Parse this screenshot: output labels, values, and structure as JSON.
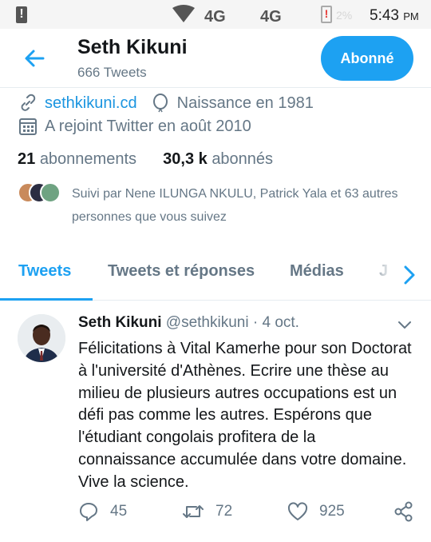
{
  "status_bar": {
    "network_1": "4G",
    "network_2": "4G",
    "battery": "2%",
    "time": "5:43",
    "ampm": "PM"
  },
  "header": {
    "name": "Seth Kikuni",
    "tweet_count": "666 Tweets",
    "follow_button": "Abonné"
  },
  "profile": {
    "website": "sethkikuni.cd",
    "birth": "Naissance en 1981",
    "joined": "A rejoint Twitter en août 2010",
    "following_count": "21",
    "following_label": "abonnements",
    "followers_count": "30,3 k",
    "followers_label": "abonnés",
    "followed_by": "Suivi par Nene ILUNGA NKULU, Patrick Yala et 63 autres personnes que vous suivez"
  },
  "tabs": [
    "Tweets",
    "Tweets et réponses",
    "Médias",
    "J"
  ],
  "tweet": {
    "author": "Seth Kikuni",
    "handle": "@sethkikuni",
    "separator": "·",
    "date": "4 oct.",
    "text": "Félicitations à Vital Kamerhe pour son Doctorat à l'université d'Athènes. Ecrire une thèse au milieu de plusieurs autres occupations est un défi pas comme les autres. Espérons que l'étudiant congolais profitera de la connaissance accumulée dans votre domaine. Vive la science.",
    "replies": "45",
    "retweets": "72",
    "likes": "925"
  },
  "colors": {
    "accent": "#1da1f2",
    "link": "#1b95e0",
    "secondary_text": "#657786"
  }
}
